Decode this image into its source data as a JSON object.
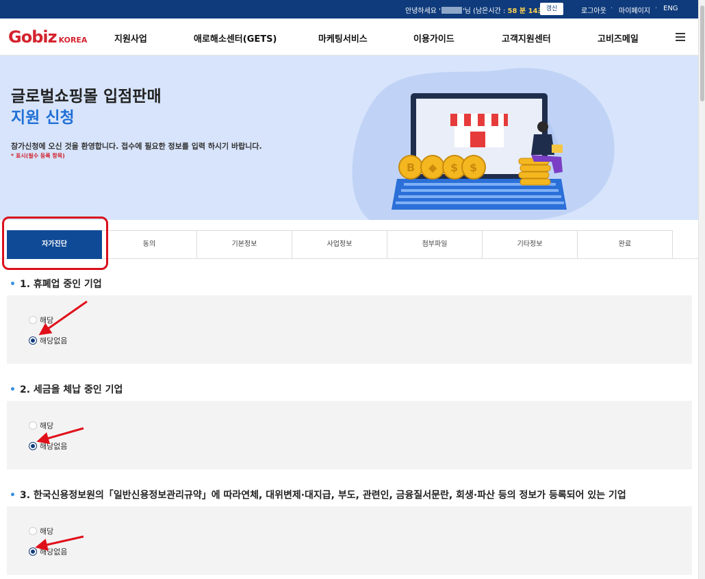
{
  "topbar": {
    "greeting_prefix": "안녕하세요 '",
    "greeting_suffix": "'님 (남은시간 : ",
    "time_left": "58 분 14초",
    "greeting_close": ")",
    "renew_label": "갱신",
    "logout": "로그아웃",
    "mypage": "마이페이지",
    "lang": "ENG",
    "separator": "·"
  },
  "nav": {
    "logo_main": "Gobiz",
    "logo_sub": "KOREA",
    "menu": [
      "지원사업",
      "애로해소센터(GETS)",
      "마케팅서비스",
      "이용가이드",
      "고객지원센터",
      "고비즈메일"
    ]
  },
  "hero": {
    "title_line1": "글로벌쇼핑몰 입점판매",
    "title_line2": "지원 신청",
    "description": "참가신청에 오신 것을 환영합니다. 접수에 필요한 정보를 입력 하시기 바랍니다.",
    "required_note": "* 표시(필수 등록 항목)"
  },
  "tabs": [
    "자가진단",
    "동의",
    "기본정보",
    "사업정보",
    "첨부파일",
    "기타정보",
    "완료"
  ],
  "active_tab": "자가진단",
  "questions": [
    {
      "title": "1. 휴폐업 중인 기업",
      "options": [
        "해당",
        "해당없음"
      ],
      "selected": "해당없음"
    },
    {
      "title": "2. 세금을 체납 중인 기업",
      "options": [
        "해당",
        "해당없음"
      ],
      "selected": "해당없음"
    },
    {
      "title": "3. 한국신용정보원의「일반신용정보관리규약」에 따라연체, 대위변제·대지급, 부도, 관련인, 금융질서문란, 회생·파산 등의 정보가 등록되어 있는 기업",
      "options": [
        "해당",
        "해당없음"
      ],
      "selected": "해당없음"
    }
  ],
  "colors": {
    "topbar": "#0f3b7c",
    "active_tab": "#0f4a96",
    "hero_bg": "#d7e4fb",
    "accent_blue": "#1f6fd6",
    "annotation_red": "#d90f1b"
  }
}
